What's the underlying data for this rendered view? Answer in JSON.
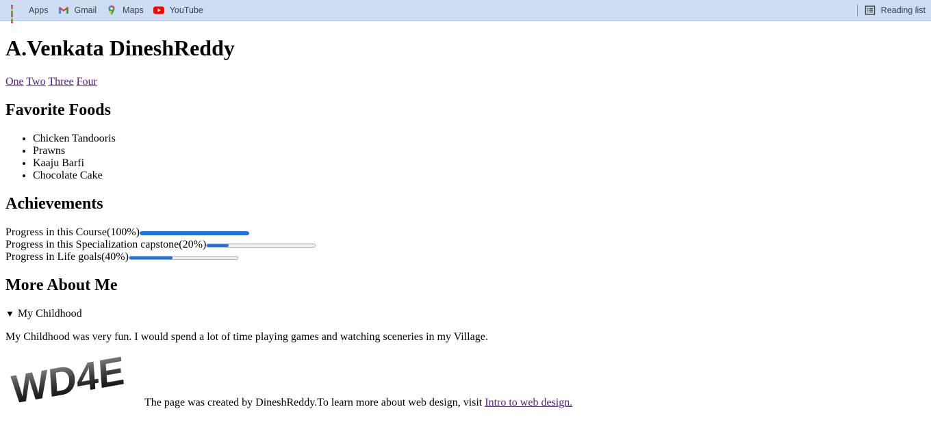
{
  "bookmarks": {
    "items": [
      {
        "label": "Apps",
        "icon": "apps-grid-icon"
      },
      {
        "label": "Gmail",
        "icon": "gmail-icon"
      },
      {
        "label": "Maps",
        "icon": "maps-icon"
      },
      {
        "label": "YouTube",
        "icon": "youtube-icon"
      }
    ],
    "reading_list": "Reading list"
  },
  "page": {
    "title": "A.Venkata DineshReddy",
    "nav": [
      "One",
      "Two",
      "Three",
      "Four"
    ],
    "foods": {
      "heading": "Favorite Foods",
      "items": [
        "Chicken Tandooris",
        "Prawns",
        "Kaaju Barfi",
        "Chocolate Cake"
      ]
    },
    "achievements": {
      "heading": "Achievements",
      "items": [
        {
          "label": "Progress in this Course(100%)",
          "progress": 1.0
        },
        {
          "label": "Progress in this Specialization capstone(20%)",
          "progress": 0.2
        },
        {
          "label": "Progress in Life goals(40%)",
          "progress": 0.4
        }
      ]
    },
    "about": {
      "heading": "More About Me",
      "summary": "My Childhood",
      "text": "My Childhood was very fun. I would spend a lot of time playing games and watching sceneries in my Village."
    },
    "footer": {
      "logo_text": "WD4E",
      "text": "The page was created by DineshReddy.To learn more about web design, visit ",
      "link": "Intro to web design."
    }
  },
  "colors": {
    "bookmark_bar": "#cddef4",
    "progress_fill": "#1a73e8",
    "visited_link": "#551a8b"
  }
}
